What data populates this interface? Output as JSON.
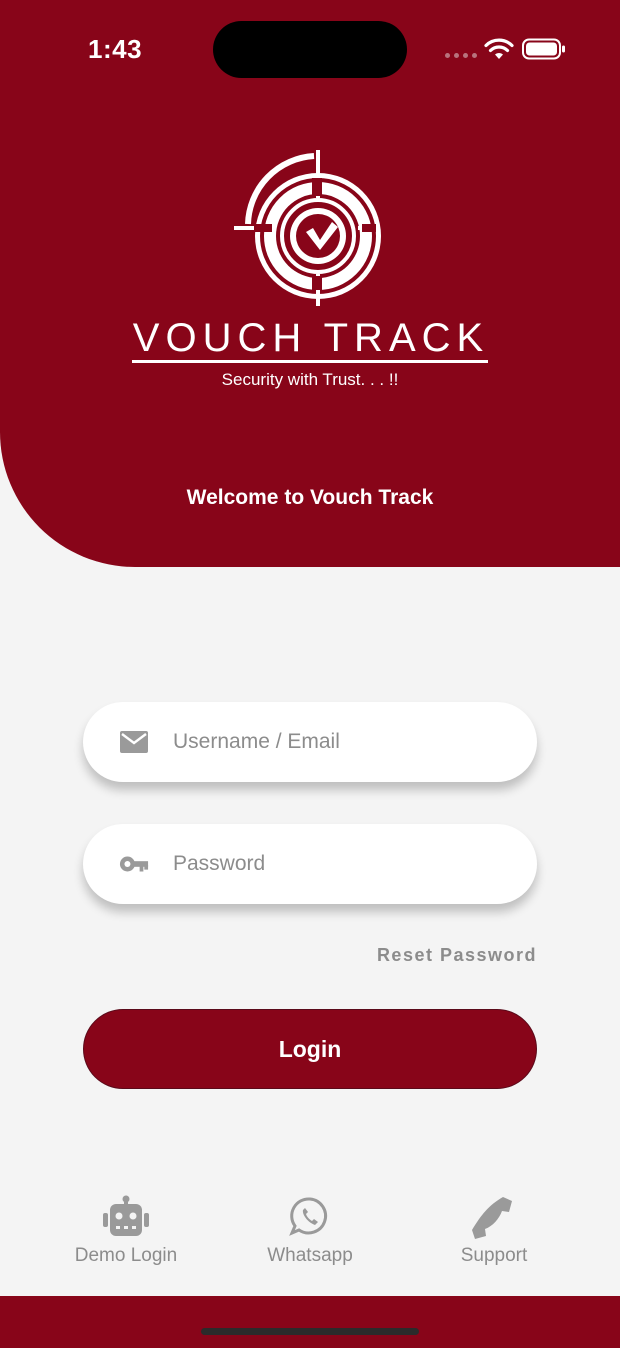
{
  "status_bar": {
    "time": "1:43",
    "wifi_icon": "wifi-icon",
    "battery_icon": "battery-icon"
  },
  "brand": {
    "name": "VOUCH TRACK",
    "tagline": "Security with Trust. . . !!",
    "logo_icon": "crosshair-check-logo",
    "accent_color": "#880519"
  },
  "welcome_text": "Welcome to Vouch Track",
  "form": {
    "username_placeholder": "Username / Email",
    "username_icon": "envelope-icon",
    "password_placeholder": "Password",
    "password_icon": "key-icon",
    "reset_label": "Reset Password",
    "login_label": "Login"
  },
  "actions": [
    {
      "label": "Demo Login",
      "icon": "robot-icon"
    },
    {
      "label": "Whatsapp",
      "icon": "whatsapp-icon"
    },
    {
      "label": "Support",
      "icon": "phone-icon"
    }
  ]
}
